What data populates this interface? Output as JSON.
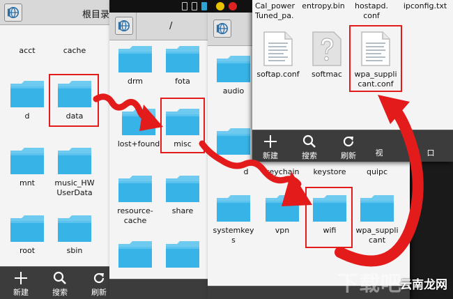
{
  "panel1": {
    "title": "根目录",
    "items": [
      "acct",
      "cache",
      "d",
      "data",
      "mnt",
      "music_HW\nUserData",
      "root",
      "sbin"
    ],
    "toolbar": [
      "新建",
      "搜索",
      "刷新"
    ]
  },
  "panel2": {
    "title": "/",
    "items": [
      "drm",
      "fota",
      "lost+found",
      "misc",
      "resource-\ncache",
      "share"
    ]
  },
  "panel3": {
    "top_labels": [
      "d",
      "keychain",
      "keystore",
      "quipc"
    ],
    "items": [
      "audio",
      "systemkey\ns",
      "vpn",
      "wifi",
      "wpa_suppli\ncant"
    ]
  },
  "panel4": {
    "top_labels": [
      "Cal_power\nTuned_pa.",
      "entropy.bin",
      "hostapd.\nconf",
      "ipconfig.txt"
    ],
    "files": [
      "softap.conf",
      "softmac",
      "wpa_suppli\ncant.conf"
    ],
    "toolbar": [
      "新建",
      "搜索",
      "刷新",
      "视",
      "口"
    ]
  },
  "watermark": {
    "ghost": "下载吧",
    "text": "云南龙网"
  },
  "colors": {
    "folder": "#38b3e7",
    "folder_tab": "#6fcaf0",
    "highlight": "#e41b1b",
    "toolbar": "#3c3c3c"
  }
}
